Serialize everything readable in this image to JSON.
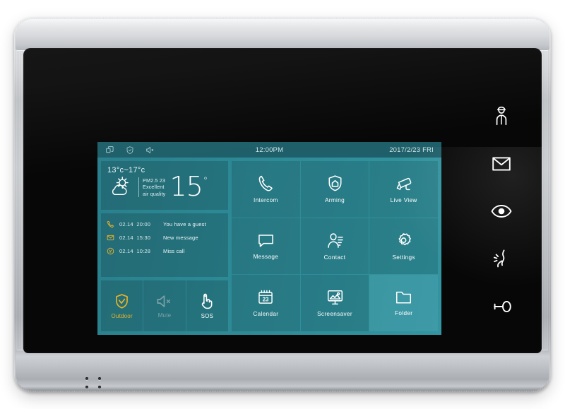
{
  "device": {
    "name": "video-intercom-indoor-monitor",
    "bezel_color": "#c3c6ca",
    "glass_color": "#070707"
  },
  "hardware_keys": [
    {
      "id": "concierge",
      "icon": "guard-person-icon",
      "label": "Call Management Centre"
    },
    {
      "id": "message",
      "icon": "envelope-icon",
      "label": "Message"
    },
    {
      "id": "view",
      "icon": "eye-icon",
      "label": "Live View"
    },
    {
      "id": "talk",
      "icon": "talk-icon",
      "label": "Talk"
    },
    {
      "id": "unlock",
      "icon": "key-icon",
      "label": "Unlock"
    }
  ],
  "screen": {
    "statusbar": {
      "icons": [
        {
          "id": "multiwindow",
          "icon": "windows-icon"
        },
        {
          "id": "arming",
          "icon": "shield-icon"
        },
        {
          "id": "mute",
          "icon": "speaker-mute-icon"
        }
      ],
      "time": "12:00PM",
      "date": "2017/2/23  FRI"
    },
    "weather": {
      "range": "13°c~17°c",
      "icon": "sun-cloud-icon",
      "pm_label": "PM2.5",
      "pm_value": "23",
      "quality_line1": "Excellent",
      "quality_line2": "air quality",
      "temperature": "15",
      "degree": "°"
    },
    "events": [
      {
        "icon": "phone-icon",
        "date": "02.14",
        "time": "20:00",
        "text": "You have a guest",
        "color": "#e8b429"
      },
      {
        "icon": "mail-icon",
        "date": "02.14",
        "time": "15:30",
        "text": "New message",
        "color": "#e8b429"
      },
      {
        "icon": "missed-icon",
        "date": "02.14",
        "time": "10:28",
        "text": "Miss call",
        "color": "#e8b429"
      }
    ],
    "quick_controls": [
      {
        "id": "outdoor",
        "icon": "shield-check-icon",
        "label": "Outdoor",
        "state": "active",
        "color": "#e8b429"
      },
      {
        "id": "mute",
        "icon": "speaker-mute-icon",
        "label": "Mute",
        "state": "disabled",
        "color": "#7fa3a9"
      },
      {
        "id": "sos",
        "icon": "hand-tap-icon",
        "label": "SOS",
        "state": "normal",
        "color": "#ffffff"
      }
    ],
    "apps": [
      {
        "id": "intercom",
        "icon": "handset-icon",
        "label": "Intercom",
        "highlight": false
      },
      {
        "id": "arming",
        "icon": "shield-home-icon",
        "label": "Arming",
        "highlight": false
      },
      {
        "id": "live-view",
        "icon": "cctv-camera-icon",
        "label": "Live  View",
        "highlight": false
      },
      {
        "id": "message",
        "icon": "chat-bubble-icon",
        "label": "Message",
        "highlight": false
      },
      {
        "id": "contact",
        "icon": "contact-icon",
        "label": "Contact",
        "highlight": false
      },
      {
        "id": "settings",
        "icon": "gear-icon",
        "label": "Settings",
        "highlight": false
      },
      {
        "id": "calendar",
        "icon": "calendar-icon",
        "label": "Calendar",
        "highlight": false,
        "day": "23"
      },
      {
        "id": "screensaver",
        "icon": "picture-icon",
        "label": "Screensaver",
        "highlight": false
      },
      {
        "id": "folder",
        "icon": "folder-icon",
        "label": "Folder",
        "highlight": true
      }
    ],
    "colors": {
      "bg_start": "#2a808d",
      "bg_end": "#3295a1",
      "statusbar": "#1e5f69",
      "tile": "rgba(0,0,0,0.16)",
      "accent": "#e8b429"
    }
  }
}
